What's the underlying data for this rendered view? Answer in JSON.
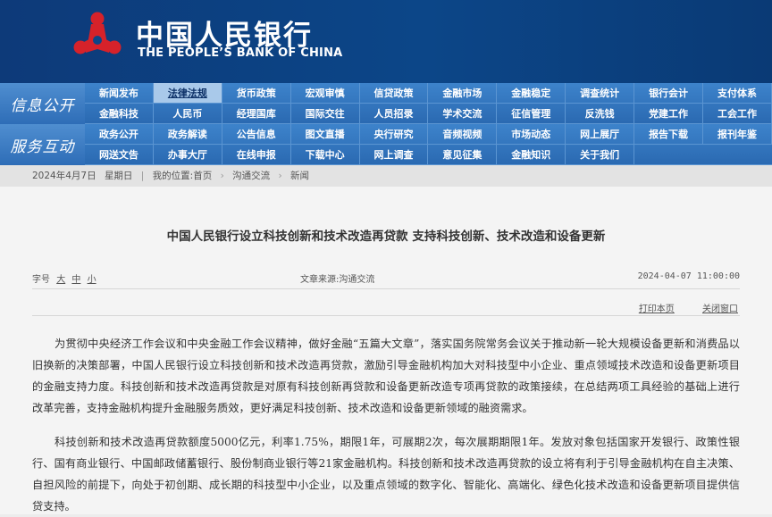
{
  "header": {
    "title_cn": "中国人民银行",
    "title_en": "THE PEOPLE’S BANK OF CHINA",
    "logo_color": "#d6222a"
  },
  "nav": {
    "info_title": "信息公开",
    "info_row1": [
      "新闻发布",
      "法律法规",
      "货币政策",
      "宏观审慎",
      "信贷政策",
      "金融市场",
      "金融稳定",
      "调查统计",
      "银行会计",
      "支付体系"
    ],
    "info_row2": [
      "金融科技",
      "人民币",
      "经理国库",
      "国际交往",
      "人员招录",
      "学术交流",
      "征信管理",
      "反洗钱",
      "党建工作",
      "工会工作"
    ],
    "service_title": "服务互动",
    "service_row1": [
      "政务公开",
      "政务解读",
      "公告信息",
      "图文直播",
      "央行研究",
      "音频视频",
      "市场动态",
      "网上展厅",
      "报告下载",
      "报刊年鉴"
    ],
    "service_row2": [
      "网送文告",
      "办事大厅",
      "在线申报",
      "下载中心",
      "网上调查",
      "意见征集",
      "金融知识",
      "关于我们"
    ],
    "active": "法律法规"
  },
  "breadcrumb": {
    "date": "2024年4月7日",
    "weekday": "星期日",
    "location_label": "我的位置:首页",
    "level1": "沟通交流",
    "level2": "新闻"
  },
  "article": {
    "title": "中国人民银行设立科技创新和技术改造再贷款 支持科技创新、技术改造和设备更新",
    "font_label": "字号",
    "font_large": "大",
    "font_medium": "中",
    "font_small": "小",
    "source": "文章来源:沟通交流",
    "datetime": "2024-04-07 11:00:00",
    "print": "打印本页",
    "close": "关闭窗口",
    "paragraph1": "为贯彻中央经济工作会议和中央金融工作会议精神，做好金融“五篇大文章”，落实国务院常务会议关于推动新一轮大规模设备更新和消费品以旧换新的决策部署，中国人民银行设立科技创新和技术改造再贷款，激励引导金融机构加大对科技型中小企业、重点领域技术改造和设备更新项目的金融支持力度。科技创新和技术改造再贷款是对原有科技创新再贷款和设备更新改造专项再贷款的政策接续，在总结两项工具经验的基础上进行改革完善，支持金融机构提升金融服务质效，更好满足科技创新、技术改造和设备更新领域的融资需求。",
    "paragraph2": "科技创新和技术改造再贷款额度5000亿元，利率1.75%，期限1年，可展期2次，每次展期期限1年。发放对象包括国家开发银行、政策性银行、国有商业银行、中国邮政储蓄银行、股份制商业银行等21家金融机构。科技创新和技术改造再贷款的设立将有利于引导金融机构在自主决策、自担风险的前提下，向处于初创期、成长期的科技型中小企业，以及重点领域的数字化、智能化、高端化、绿色化技术改造和设备更新项目提供信贷支持。"
  }
}
